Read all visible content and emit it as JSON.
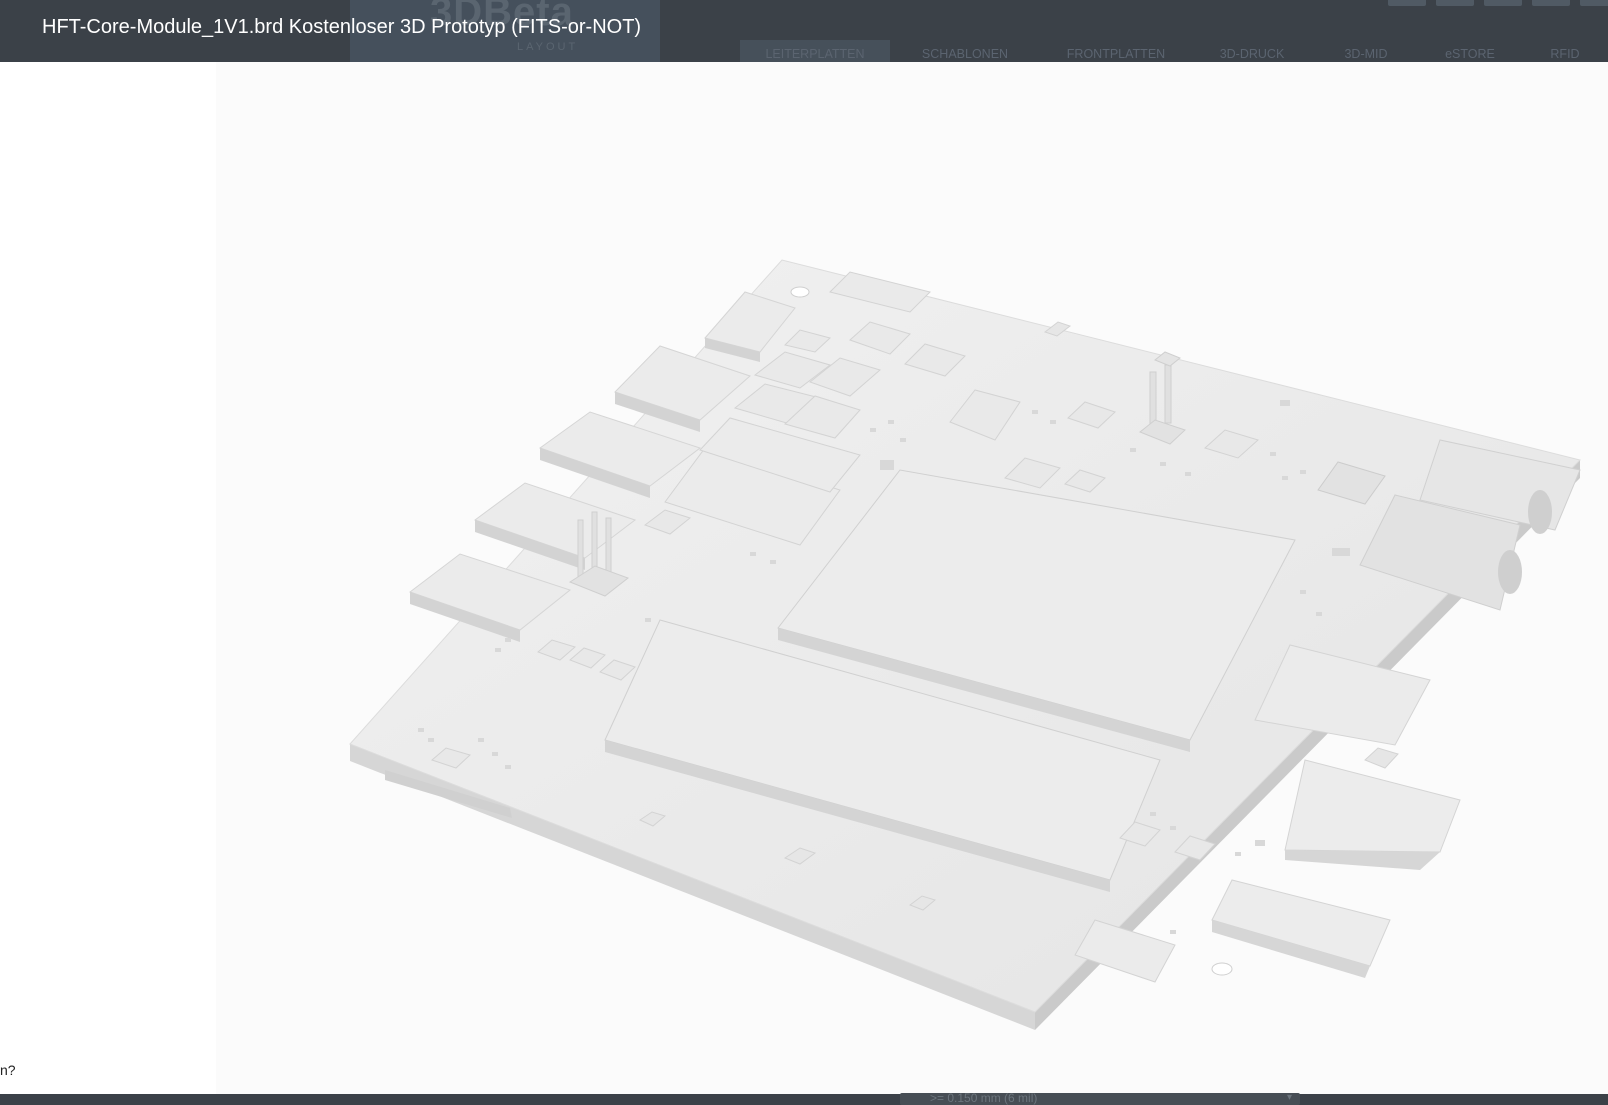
{
  "modal": {
    "title": "HFT-Core-Module_1V1.brd Kostenloser 3D Prototyp (FITS-or-NOT)"
  },
  "site": {
    "logo": "3DBeta",
    "logo_sub": "LAYOUT",
    "nav": [
      {
        "label": "LEITERPLATTEN",
        "active": true
      },
      {
        "label": "SCHABLONEN",
        "active": false
      },
      {
        "label": "FRONTPLATTEN",
        "active": false
      },
      {
        "label": "3D-DRUCK",
        "active": false
      },
      {
        "label": "3D-MID",
        "active": false
      },
      {
        "label": "eSTORE",
        "active": false
      },
      {
        "label": "RFID",
        "active": false
      }
    ]
  },
  "left_fragment": "n?",
  "bottom_field": {
    "value": ">= 0.150 mm (6 mil)"
  },
  "colors": {
    "header_bg": "#3b4148",
    "pcb_top": "#ececec",
    "pcb_side": "#d2d2d2"
  }
}
